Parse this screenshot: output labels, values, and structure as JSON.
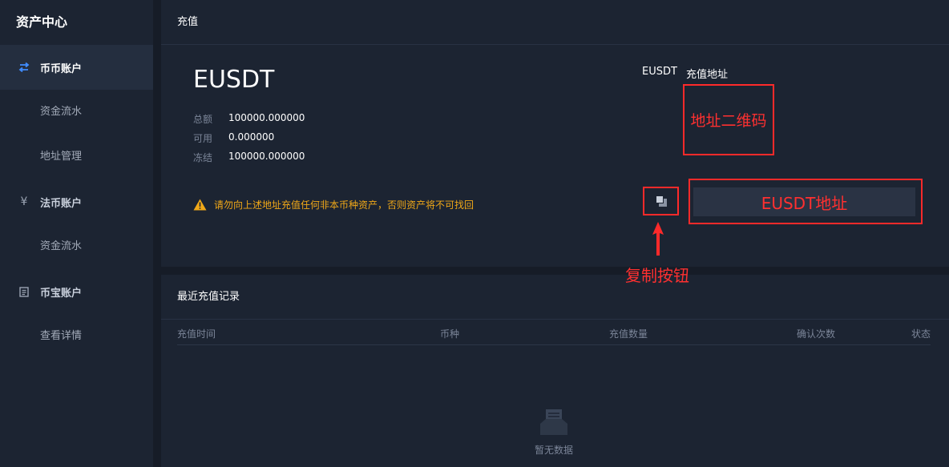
{
  "sidebar": {
    "title": "资产中心",
    "groups": [
      {
        "icon": "exchange-arrows-icon",
        "label": "币币账户",
        "active": true,
        "subs": [
          "资金流水",
          "地址管理"
        ]
      },
      {
        "icon": "yen-icon",
        "label": "法币账户",
        "active": false,
        "subs": [
          "资金流水"
        ]
      },
      {
        "icon": "ledger-icon",
        "label": "币宝账户",
        "active": false,
        "subs": [
          "查看详情"
        ]
      }
    ]
  },
  "deposit": {
    "header": "充值",
    "coin": "EUSDT",
    "balances": [
      {
        "label": "总额",
        "value": "100000.000000"
      },
      {
        "label": "可用",
        "value": "0.000000"
      },
      {
        "label": "冻结",
        "value": "100000.000000"
      }
    ],
    "warning": "请勿向上述地址充值任何非本币种资产，否则资产将不可找回",
    "address_coin": "EUSDT",
    "address_title": "充值地址",
    "qr_placeholder": "地址二维码",
    "address_value": "EUSDT地址",
    "copy_annotation": "复制按钮",
    "annotation_color": "#ff2a2a"
  },
  "records": {
    "header": "最近充值记录",
    "columns": [
      "充值时间",
      "币种",
      "充值数量",
      "确认次数",
      "状态"
    ],
    "rows": [],
    "empty_text": "暂无数据"
  },
  "colors": {
    "accent": "#3f8cff",
    "warning": "#f0a818",
    "panel": "#1c2432",
    "background": "#161c27"
  }
}
